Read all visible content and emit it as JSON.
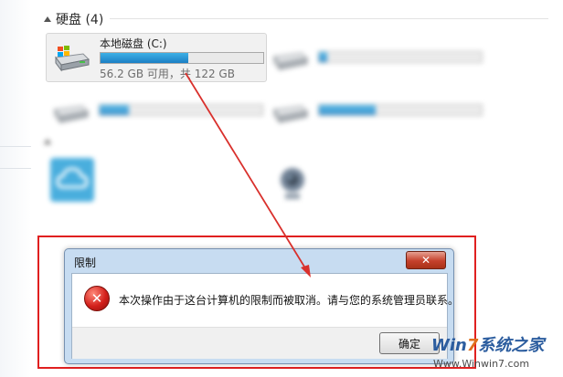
{
  "explorer": {
    "hard_disk_group": {
      "title": "硬盘 (4)"
    },
    "device_group": {
      "title": ""
    },
    "drives": [
      {
        "name": "本地磁盘 (C:)",
        "size": "56.2 GB 可用，共 122 GB",
        "used_percent": 54,
        "selected": true
      },
      {
        "name": "",
        "size": "",
        "used_percent": 5
      },
      {
        "name": "",
        "size": "",
        "used_percent": 18
      },
      {
        "name": "",
        "size": "",
        "used_percent": 35
      }
    ],
    "devices": [
      {
        "name": "",
        "icon": "cloud-icon"
      },
      {
        "name": "",
        "icon": "webcam-icon"
      }
    ]
  },
  "dialog": {
    "title": "限制",
    "close_glyph": "✕",
    "icon": "error-icon",
    "icon_glyph": "✕",
    "message": "本次操作由于这台计算机的限制而被取消。请与您的系统管理员联系。",
    "ok_label": "确定"
  },
  "annotation": {
    "color": "#e02020"
  },
  "watermark": {
    "logo_prefix": "Win",
    "logo_seven": "7",
    "logo_suffix": "系统之家",
    "site": "Www.Winwin7.com"
  },
  "colors": {
    "accent_bar": "#1b7fc4",
    "dialog_frame": "#c7dcf1",
    "close_red": "#c5402b"
  }
}
